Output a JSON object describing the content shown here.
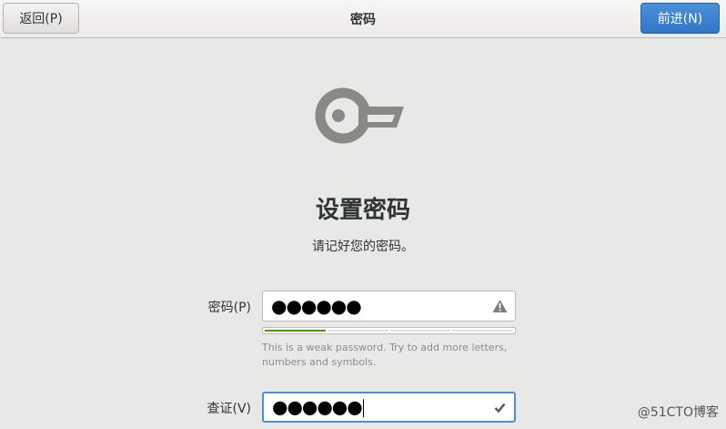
{
  "header": {
    "back_label": "返回(P)",
    "title": "密码",
    "next_label": "前进(N)"
  },
  "icon": "key-icon",
  "heading": "设置密码",
  "subtitle": "请记好您的密码。",
  "password": {
    "label": "密码(P)",
    "masked_value": "●●●●●●",
    "status_icon": "warning-icon"
  },
  "strength": {
    "level": 0.25,
    "segments": 4,
    "hint": "This is a weak password. Try to add more letters, numbers and symbols."
  },
  "confirm": {
    "label": "查证(V)",
    "masked_value": "●●●●●●",
    "status_icon": "checkmark-icon"
  },
  "watermark": "@51CTO博客",
  "colors": {
    "accent": "#4a90d9",
    "strength_fill": "#4e9a06",
    "background": "#e8e8e7",
    "icon_gray": "#888a85"
  }
}
